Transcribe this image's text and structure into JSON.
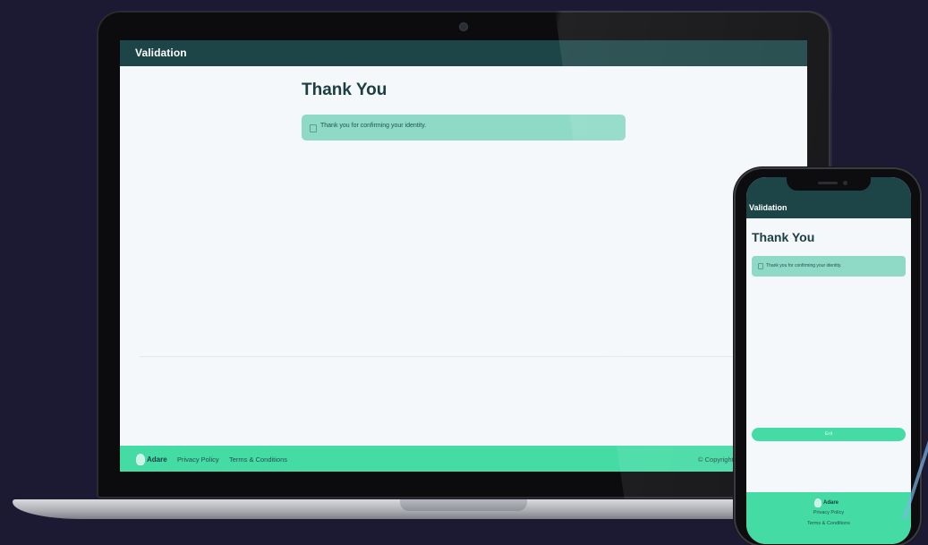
{
  "laptop": {
    "brand": "Validation",
    "title": "Thank You",
    "alert": "Thank you for confirming your identity.",
    "footer": {
      "logo_text": "Adare",
      "privacy": "Privacy Policy",
      "terms": "Terms & Conditions",
      "copyright": "© Copyright"
    }
  },
  "phone": {
    "brand": "Validation",
    "title": "Thank You",
    "alert": "Thank you for confirming your identity.",
    "exit_label": "Exit",
    "footer": {
      "logo_text": "Adare",
      "privacy": "Privacy Policy",
      "terms": "Terms & Conditions"
    }
  },
  "colors": {
    "header": "#1d4547",
    "alert_bg": "#8fdac7",
    "footer_bg": "#44dba5",
    "background": "#1c1a33"
  }
}
